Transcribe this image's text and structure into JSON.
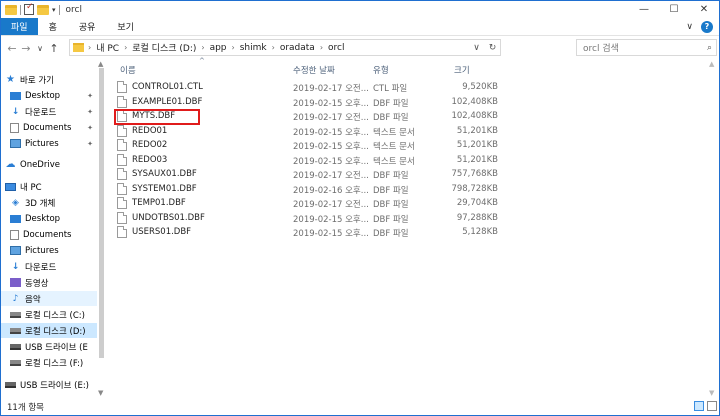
{
  "window": {
    "title": "orcl",
    "controls": {
      "minimize": "—",
      "maximize": "☐",
      "close": "✕"
    }
  },
  "ribbon": {
    "tabs": [
      {
        "label": "파일"
      },
      {
        "label": "홈"
      },
      {
        "label": "공유"
      },
      {
        "label": "보기"
      }
    ],
    "expand": "∨",
    "help": "?"
  },
  "nav": {
    "back": "←",
    "forward": "→",
    "recent": "∨",
    "up": "↑"
  },
  "address": {
    "crumbs": [
      "내 PC",
      "로컬 디스크 (D:)",
      "app",
      "shimk",
      "oradata",
      "orcl"
    ],
    "dropdown": "∨",
    "refresh": "↻"
  },
  "search": {
    "placeholder": "orcl 검색",
    "icon": "⌕"
  },
  "sidebar": {
    "items": [
      {
        "label": "바로 가기",
        "icon": "star-icon",
        "pinned": false
      },
      {
        "label": "Desktop",
        "icon": "desktop-icon",
        "pinned": true
      },
      {
        "label": "다운로드",
        "icon": "download-icon",
        "pinned": true
      },
      {
        "label": "Documents",
        "icon": "documents-icon",
        "pinned": true
      },
      {
        "label": "Pictures",
        "icon": "pictures-icon",
        "pinned": true
      },
      {
        "label": "OneDrive",
        "icon": "onedrive-icon",
        "pinned": false
      },
      {
        "label": "내 PC",
        "icon": "pc-icon",
        "pinned": false
      },
      {
        "label": "3D 개체",
        "icon": "3d-objects-icon",
        "pinned": false
      },
      {
        "label": "Desktop",
        "icon": "desktop-icon",
        "pinned": false
      },
      {
        "label": "Documents",
        "icon": "documents-icon",
        "pinned": false
      },
      {
        "label": "Pictures",
        "icon": "pictures-icon",
        "pinned": false
      },
      {
        "label": "다운로드",
        "icon": "download-icon",
        "pinned": false
      },
      {
        "label": "동영상",
        "icon": "videos-icon",
        "pinned": false
      },
      {
        "label": "음악",
        "icon": "music-icon",
        "pinned": false
      },
      {
        "label": "로컬 디스크 (C:)",
        "icon": "drive-icon",
        "pinned": false
      },
      {
        "label": "로컬 디스크 (D:)",
        "icon": "drive-icon",
        "pinned": false
      },
      {
        "label": "USB 드라이브 (E",
        "icon": "usb-icon",
        "pinned": false
      },
      {
        "label": "로컬 디스크 (F:)",
        "icon": "drive-icon",
        "pinned": false
      },
      {
        "label": "USB 드라이브 (E:)",
        "icon": "usb-icon",
        "pinned": false
      }
    ],
    "pin_glyph": "📌"
  },
  "columns": {
    "name": "이름",
    "date": "수정한 날짜",
    "type": "유형",
    "size": "크기"
  },
  "files": [
    {
      "name": "CONTROL01.CTL",
      "date": "2019-02-17 오전...",
      "type": "CTL 파일",
      "size": "9,520KB"
    },
    {
      "name": "EXAMPLE01.DBF",
      "date": "2019-02-15 오후...",
      "type": "DBF 파일",
      "size": "102,408KB"
    },
    {
      "name": "MYTS.DBF",
      "date": "2019-02-17 오전...",
      "type": "DBF 파일",
      "size": "102,408KB"
    },
    {
      "name": "REDO01",
      "date": "2019-02-15 오후...",
      "type": "텍스트 문서",
      "size": "51,201KB"
    },
    {
      "name": "REDO02",
      "date": "2019-02-15 오후...",
      "type": "텍스트 문서",
      "size": "51,201KB"
    },
    {
      "name": "REDO03",
      "date": "2019-02-15 오후...",
      "type": "텍스트 문서",
      "size": "51,201KB"
    },
    {
      "name": "SYSAUX01.DBF",
      "date": "2019-02-17 오전...",
      "type": "DBF 파일",
      "size": "757,768KB"
    },
    {
      "name": "SYSTEM01.DBF",
      "date": "2019-02-16 오후...",
      "type": "DBF 파일",
      "size": "798,728KB"
    },
    {
      "name": "TEMP01.DBF",
      "date": "2019-02-17 오전...",
      "type": "DBF 파일",
      "size": "29,704KB"
    },
    {
      "name": "UNDOTBS01.DBF",
      "date": "2019-02-15 오후...",
      "type": "DBF 파일",
      "size": "97,288KB"
    },
    {
      "name": "USERS01.DBF",
      "date": "2019-02-15 오후...",
      "type": "DBF 파일",
      "size": "5,128KB"
    }
  ],
  "status": {
    "item_count": "11개 항목"
  },
  "colors": {
    "accent": "#1979ca",
    "selected_nav": "#cce8ff",
    "highlight": "#e01b1b"
  }
}
